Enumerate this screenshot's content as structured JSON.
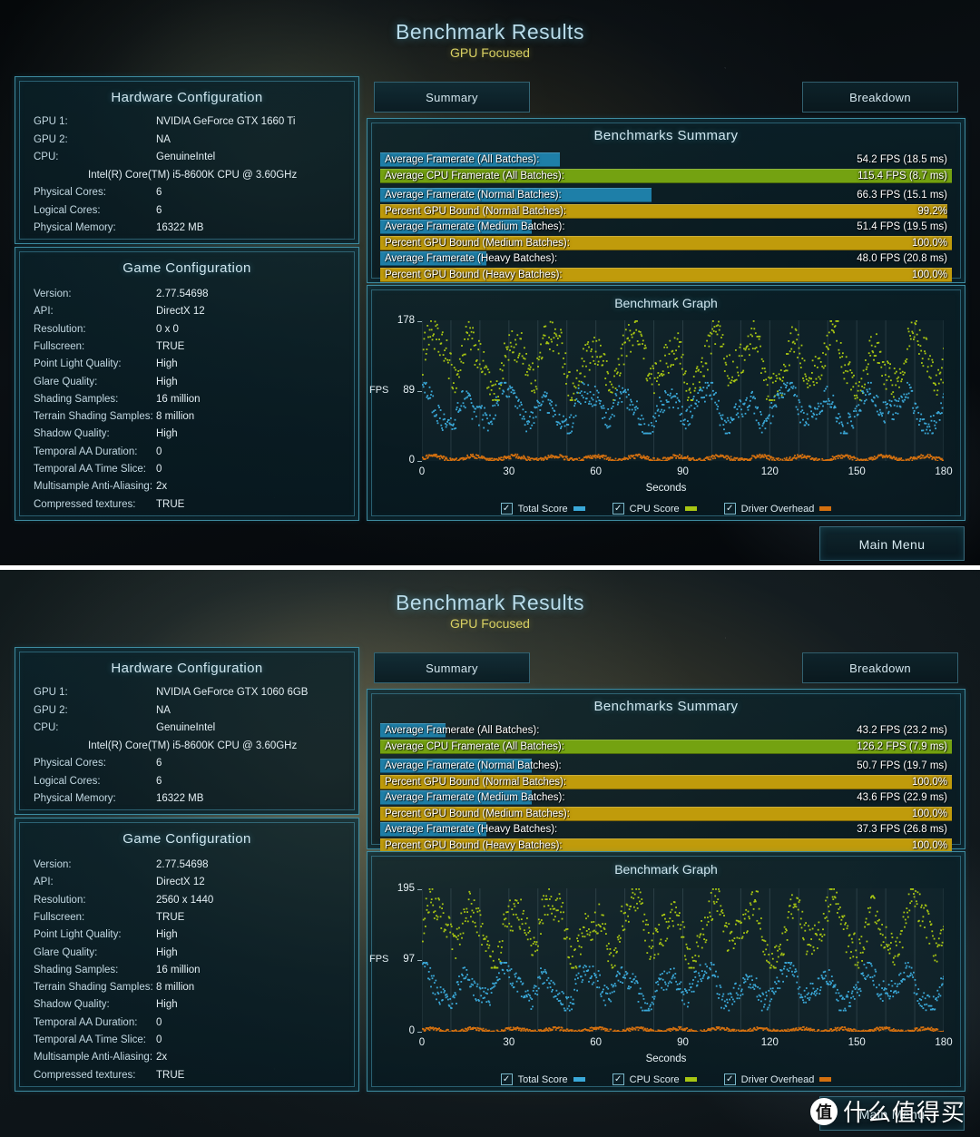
{
  "watermark": {
    "logo_char": "值",
    "text": "什么值得买"
  },
  "shots": [
    {
      "id": "top",
      "header": {
        "title": "Benchmark Results",
        "subtitle": "GPU Focused"
      },
      "hardware": {
        "panel_title": "Hardware Configuration",
        "rows": [
          {
            "key": "GPU 1:",
            "value": "NVIDIA GeForce GTX 1660 Ti"
          },
          {
            "key": "GPU 2:",
            "value": "NA"
          },
          {
            "key": "CPU:",
            "value": "GenuineIntel"
          },
          {
            "key": "",
            "value": "Intel(R) Core(TM) i5-8600K CPU @ 3.60GHz",
            "wide": true
          },
          {
            "key": "Physical Cores:",
            "value": "6"
          },
          {
            "key": "Logical Cores:",
            "value": "6"
          },
          {
            "key": "Physical Memory:",
            "value": "16322  MB"
          }
        ]
      },
      "game": {
        "panel_title": "Game Configuration",
        "rows": [
          {
            "key": "Version:",
            "value": "2.77.54698"
          },
          {
            "key": "API:",
            "value": "DirectX 12"
          },
          {
            "key": "Resolution:",
            "value": "0 x 0"
          },
          {
            "key": "Fullscreen:",
            "value": "TRUE"
          },
          {
            "key": "Point Light Quality:",
            "value": "High"
          },
          {
            "key": "Glare Quality:",
            "value": "High"
          },
          {
            "key": "Shading Samples:",
            "value": "16 million"
          },
          {
            "key": "Terrain Shading Samples:",
            "value": "8 million"
          },
          {
            "key": "Shadow Quality:",
            "value": "High"
          },
          {
            "key": "Temporal AA Duration:",
            "value": "0"
          },
          {
            "key": "Temporal AA Time Slice:",
            "value": "0"
          },
          {
            "key": "Multisample Anti-Aliasing:",
            "value": "2x"
          },
          {
            "key": "Compressed textures:",
            "value": "TRUE"
          }
        ]
      },
      "tabs": [
        {
          "label": "Summary",
          "active": true
        },
        {
          "label": "Breakdown",
          "active": false
        }
      ],
      "summary": {
        "panel_title": "Benchmarks Summary",
        "bars": [
          {
            "label": "Average Framerate (All Batches):",
            "value": "54.2 FPS (18.5 ms)",
            "pct": 31.5,
            "color": "#1e7fa8"
          },
          {
            "label": "Average CPU Framerate (All Batches):",
            "value": "115.4 FPS (8.7 ms)",
            "pct": 100,
            "color": "#74a211"
          },
          {
            "label": "Average Framerate (Normal Batches):",
            "value": "66.3 FPS (15.1 ms)",
            "pct": 47.5,
            "color": "#1e7fa8"
          },
          {
            "label": "Percent GPU Bound (Normal Batches):",
            "value": "99.2%",
            "pct": 99.2,
            "color": "#c09b0b"
          },
          {
            "label": "Average Framerate (Medium Batches):",
            "value": "51.4 FPS (19.5 ms)",
            "pct": 26.5,
            "color": "#1e7fa8"
          },
          {
            "label": "Percent GPU Bound (Medium Batches):",
            "value": "100.0%",
            "pct": 100,
            "color": "#c09b0b"
          },
          {
            "label": "Average Framerate (Heavy Batches):",
            "value": "48.0 FPS (20.8 ms)",
            "pct": 18.5,
            "color": "#1e7fa8"
          },
          {
            "label": "Percent GPU Bound (Heavy Batches):",
            "value": "100.0%",
            "pct": 100,
            "color": "#c09b0b"
          }
        ]
      },
      "graph": {
        "title": "Benchmark Graph",
        "y_axis_label": "FPS",
        "x_axis_label": "Seconds",
        "y_ticks": [
          "178",
          "89",
          "0"
        ],
        "x_ticks": [
          "0",
          "30",
          "60",
          "90",
          "120",
          "150",
          "180"
        ],
        "legend": [
          {
            "label": "Total Score",
            "color": "#3aa8d8",
            "checked": true
          },
          {
            "label": "CPU Score",
            "color": "#a8c613",
            "checked": true
          },
          {
            "label": "Driver Overhead",
            "color": "#d4700f",
            "checked": true
          }
        ]
      },
      "main_menu_label": "Main Menu",
      "chart_data": {
        "type": "scatter",
        "title": "Benchmark Graph",
        "xlabel": "Seconds",
        "ylabel": "FPS",
        "xlim": [
          0,
          180
        ],
        "ylim": [
          0,
          178
        ],
        "y_ticks": [
          0,
          89,
          178
        ],
        "x_ticks": [
          0,
          30,
          60,
          90,
          120,
          150,
          180
        ],
        "grid": "vertical",
        "legend_position": "bottom",
        "series": [
          {
            "name": "CPU Score",
            "color": "#a8c613",
            "mean": 115.4,
            "min": 78,
            "max": 178
          },
          {
            "name": "Total Score",
            "color": "#3aa8d8",
            "mean": 54.2,
            "min": 36,
            "max": 100
          },
          {
            "name": "Driver Overhead",
            "color": "#d4700f",
            "mean": 5,
            "min": 2,
            "max": 12
          }
        ]
      }
    },
    {
      "id": "bottom",
      "header": {
        "title": "Benchmark Results",
        "subtitle": "GPU Focused"
      },
      "hardware": {
        "panel_title": "Hardware Configuration",
        "rows": [
          {
            "key": "GPU 1:",
            "value": "NVIDIA GeForce GTX 1060 6GB"
          },
          {
            "key": "GPU 2:",
            "value": "NA"
          },
          {
            "key": "CPU:",
            "value": "GenuineIntel"
          },
          {
            "key": "",
            "value": "Intel(R) Core(TM) i5-8600K CPU @ 3.60GHz",
            "wide": true
          },
          {
            "key": "Physical Cores:",
            "value": "6"
          },
          {
            "key": "Logical Cores:",
            "value": "6"
          },
          {
            "key": "Physical Memory:",
            "value": "16322  MB"
          }
        ]
      },
      "game": {
        "panel_title": "Game Configuration",
        "rows": [
          {
            "key": "Version:",
            "value": "2.77.54698"
          },
          {
            "key": "API:",
            "value": "DirectX 12"
          },
          {
            "key": "Resolution:",
            "value": "2560 x 1440"
          },
          {
            "key": "Fullscreen:",
            "value": "TRUE"
          },
          {
            "key": "Point Light Quality:",
            "value": "High"
          },
          {
            "key": "Glare Quality:",
            "value": "High"
          },
          {
            "key": "Shading Samples:",
            "value": "16 million"
          },
          {
            "key": "Terrain Shading Samples:",
            "value": "8 million"
          },
          {
            "key": "Shadow Quality:",
            "value": "High"
          },
          {
            "key": "Temporal AA Duration:",
            "value": "0"
          },
          {
            "key": "Temporal AA Time Slice:",
            "value": "0"
          },
          {
            "key": "Multisample Anti-Aliasing:",
            "value": "2x"
          },
          {
            "key": "Compressed textures:",
            "value": "TRUE"
          }
        ]
      },
      "tabs": [
        {
          "label": "Summary",
          "active": true
        },
        {
          "label": "Breakdown",
          "active": false
        }
      ],
      "summary": {
        "panel_title": "Benchmarks Summary",
        "bars": [
          {
            "label": "Average Framerate (All Batches):",
            "value": "43.2 FPS (23.2 ms)",
            "pct": 11.5,
            "color": "#1e7fa8"
          },
          {
            "label": "Average CPU Framerate (All Batches):",
            "value": "126.2 FPS (7.9 ms)",
            "pct": 100,
            "color": "#74a211"
          },
          {
            "label": "Average Framerate (Normal Batches):",
            "value": "50.7 FPS (19.7 ms)",
            "pct": 26.5,
            "color": "#1e7fa8"
          },
          {
            "label": "Percent GPU Bound (Normal Batches):",
            "value": "100.0%",
            "pct": 100,
            "color": "#c09b0b"
          },
          {
            "label": "Average Framerate (Medium Batches):",
            "value": "43.6 FPS (22.9 ms)",
            "pct": 26.5,
            "color": "#1e7fa8"
          },
          {
            "label": "Percent GPU Bound (Medium Batches):",
            "value": "100.0%",
            "pct": 100,
            "color": "#c09b0b"
          },
          {
            "label": "Average Framerate (Heavy Batches):",
            "value": "37.3 FPS (26.8 ms)",
            "pct": 18.5,
            "color": "#1e7fa8"
          },
          {
            "label": "Percent GPU Bound (Heavy Batches):",
            "value": "100.0%",
            "pct": 100,
            "color": "#c09b0b"
          }
        ]
      },
      "graph": {
        "title": "Benchmark Graph",
        "y_axis_label": "FPS",
        "x_axis_label": "Seconds",
        "y_ticks": [
          "195",
          "97",
          "0"
        ],
        "x_ticks": [
          "0",
          "30",
          "60",
          "90",
          "120",
          "150",
          "180"
        ],
        "legend": [
          {
            "label": "Total Score",
            "color": "#3aa8d8",
            "checked": true
          },
          {
            "label": "CPU Score",
            "color": "#a8c613",
            "checked": true
          },
          {
            "label": "Driver Overhead",
            "color": "#d4700f",
            "checked": true
          }
        ]
      },
      "main_menu_label": "Main Menu",
      "chart_data": {
        "type": "scatter",
        "title": "Benchmark Graph",
        "xlabel": "Seconds",
        "ylabel": "FPS",
        "xlim": [
          0,
          180
        ],
        "ylim": [
          0,
          195
        ],
        "y_ticks": [
          0,
          97,
          195
        ],
        "x_ticks": [
          0,
          30,
          60,
          90,
          120,
          150,
          180
        ],
        "grid": "vertical",
        "legend_position": "bottom",
        "series": [
          {
            "name": "CPU Score",
            "color": "#a8c613",
            "mean": 126.2,
            "min": 88,
            "max": 195
          },
          {
            "name": "Total Score",
            "color": "#3aa8d8",
            "mean": 43.2,
            "min": 30,
            "max": 95
          },
          {
            "name": "Driver Overhead",
            "color": "#d4700f",
            "mean": 4,
            "min": 1,
            "max": 10
          }
        ]
      }
    }
  ]
}
